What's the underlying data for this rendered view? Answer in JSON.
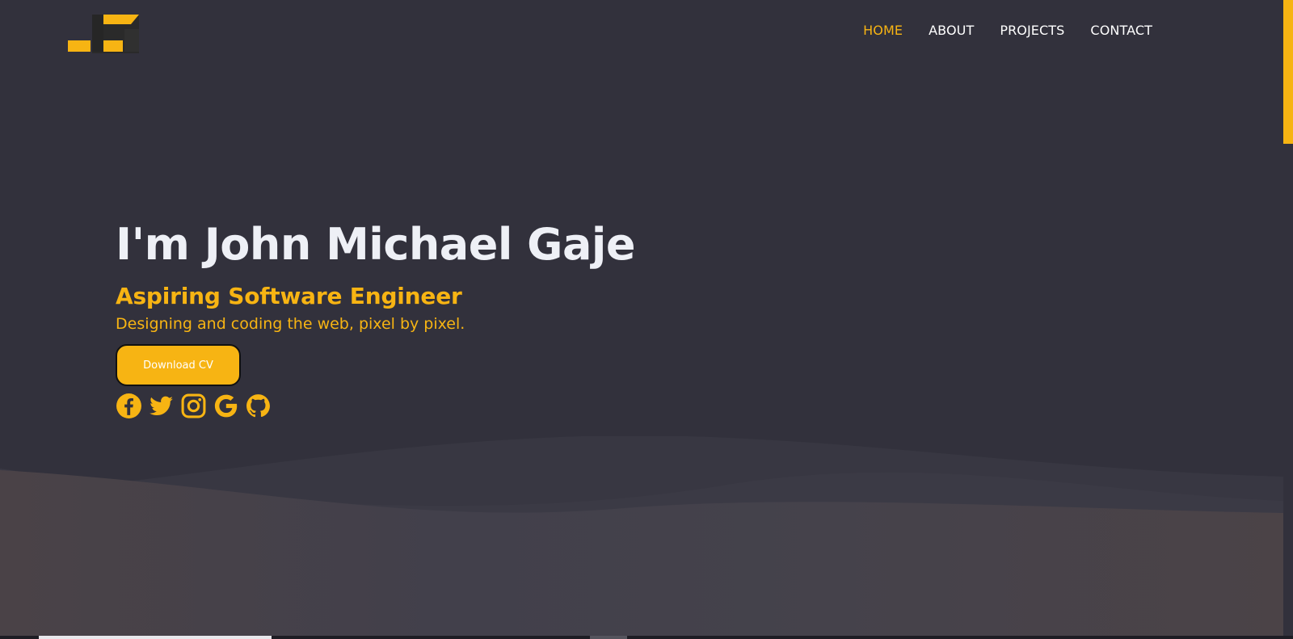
{
  "nav": {
    "items": [
      {
        "label": "HOME",
        "active": true
      },
      {
        "label": "ABOUT",
        "active": false
      },
      {
        "label": "PROJECTS",
        "active": false
      },
      {
        "label": "CONTACT",
        "active": false
      }
    ]
  },
  "hero": {
    "title": "I'm John Michael Gaje",
    "subtitle": "Aspiring Software Engineer",
    "tagline": "Designing and coding the web, pixel by pixel.",
    "cv_button": "Download CV"
  },
  "socials": [
    "facebook-icon",
    "twitter-icon",
    "instagram-icon",
    "google-icon",
    "github-icon"
  ],
  "colors": {
    "accent": "#f7b413",
    "background": "#32313c",
    "text": "#eef0f6"
  }
}
